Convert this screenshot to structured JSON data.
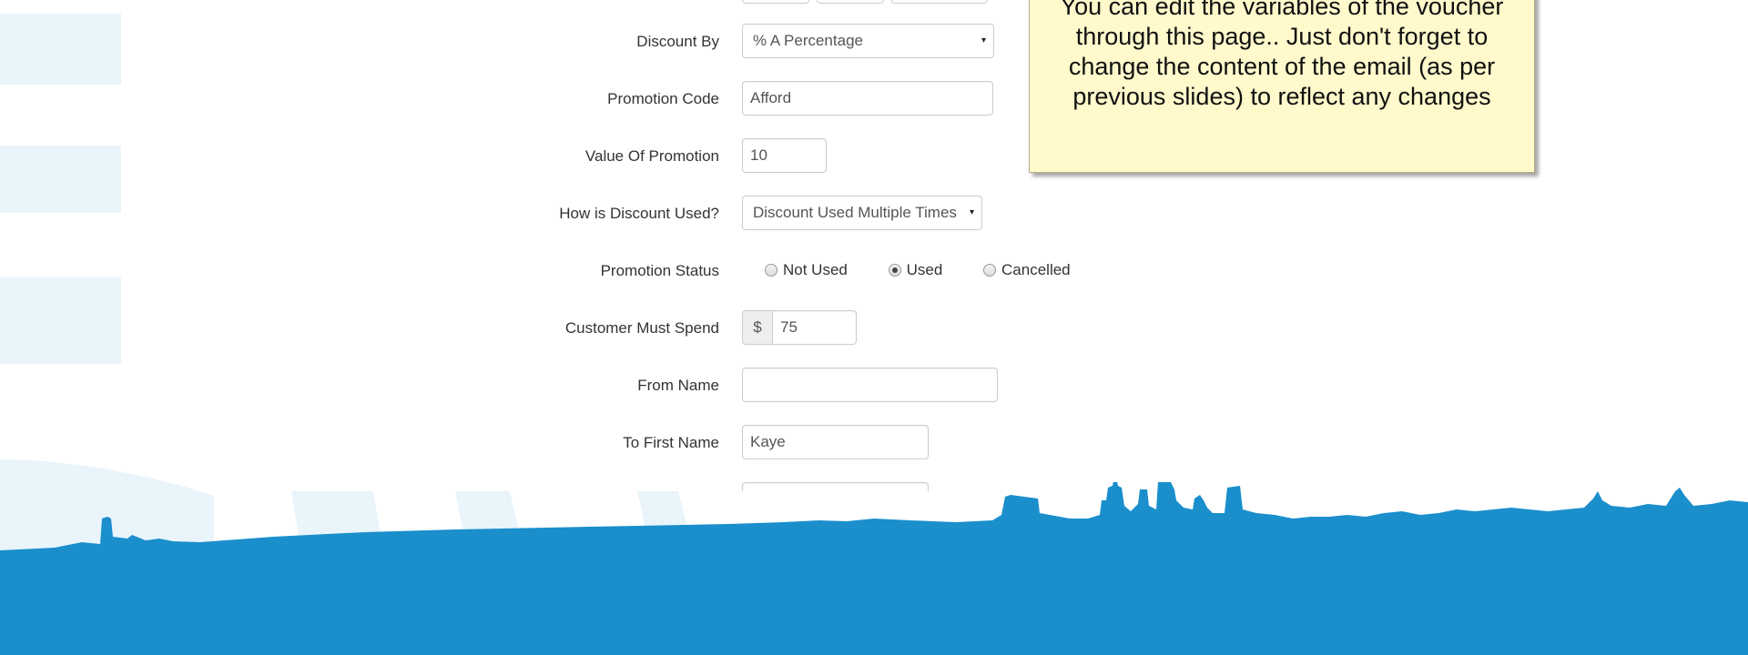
{
  "colors": {
    "sky_blue": "#1a8fcc",
    "arc_light_blue": "#e8f4fb",
    "note_background": "#fff9cc"
  },
  "form": {
    "discount_by": {
      "label": "Discount By",
      "selected": "% A Percentage",
      "caret_icon": "▾"
    },
    "promotion_code": {
      "label": "Promotion Code",
      "value": "Afford"
    },
    "value_of_promotion": {
      "label": "Value Of Promotion",
      "value": "10"
    },
    "how_discount_used": {
      "label": "How is Discount Used?",
      "selected": "Discount Used Multiple Times",
      "caret_icon": "▾"
    },
    "promotion_status": {
      "label": "Promotion Status",
      "options": [
        "Not Used",
        "Used",
        "Cancelled"
      ],
      "selected": "Used"
    },
    "customer_must_spend": {
      "label": "Customer Must Spend",
      "currency": "$",
      "value": "75"
    },
    "from_name": {
      "label": "From Name",
      "value": ""
    },
    "to_first_name": {
      "label": "To First Name",
      "value": "Kaye"
    }
  },
  "callout": {
    "text": "You can edit the variables of the voucher through this page.. Just don't forget to change the content of the email (as per previous slides) to reflect any changes"
  }
}
